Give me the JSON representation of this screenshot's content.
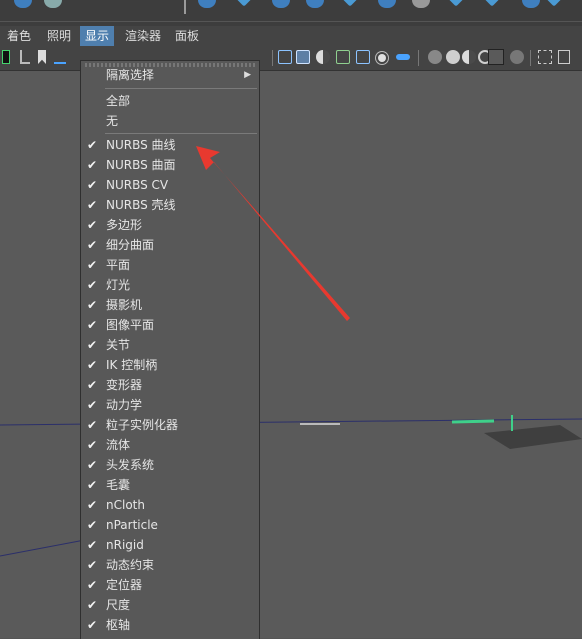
{
  "menubar": {
    "items": [
      {
        "label": "着色",
        "active": false
      },
      {
        "label": "照明",
        "active": false
      },
      {
        "label": "显示",
        "active": true
      },
      {
        "label": "渲染器",
        "active": false
      },
      {
        "label": "面板",
        "active": false
      }
    ]
  },
  "show_menu": {
    "isolate_label": "隔离选择",
    "all_label": "全部",
    "none_label": "无",
    "items": [
      {
        "label": "NURBS 曲线",
        "checked": true
      },
      {
        "label": "NURBS 曲面",
        "checked": true
      },
      {
        "label": "NURBS CV",
        "checked": true
      },
      {
        "label": "NURBS 壳线",
        "checked": true
      },
      {
        "label": "多边形",
        "checked": true
      },
      {
        "label": "细分曲面",
        "checked": true
      },
      {
        "label": "平面",
        "checked": true
      },
      {
        "label": "灯光",
        "checked": true
      },
      {
        "label": "摄影机",
        "checked": true
      },
      {
        "label": "图像平面",
        "checked": true
      },
      {
        "label": "关节",
        "checked": true
      },
      {
        "label": "IK 控制柄",
        "checked": true
      },
      {
        "label": "变形器",
        "checked": true
      },
      {
        "label": "动力学",
        "checked": true
      },
      {
        "label": "粒子实例化器",
        "checked": true
      },
      {
        "label": "流体",
        "checked": true
      },
      {
        "label": "头发系统",
        "checked": true
      },
      {
        "label": "毛囊",
        "checked": true
      },
      {
        "label": "nCloth",
        "checked": true
      },
      {
        "label": "nParticle",
        "checked": true
      },
      {
        "label": "nRigid",
        "checked": true
      },
      {
        "label": "动态约束",
        "checked": true
      },
      {
        "label": "定位器",
        "checked": true
      },
      {
        "label": "尺度",
        "checked": true
      },
      {
        "label": "枢轴",
        "checked": true
      }
    ],
    "check_glyph": "✔",
    "submenu_arrow": "▶"
  },
  "colors": {
    "accent": "#4f7fae",
    "annotation": "#e8392f",
    "viewport_bg": "#5a5a5a"
  }
}
